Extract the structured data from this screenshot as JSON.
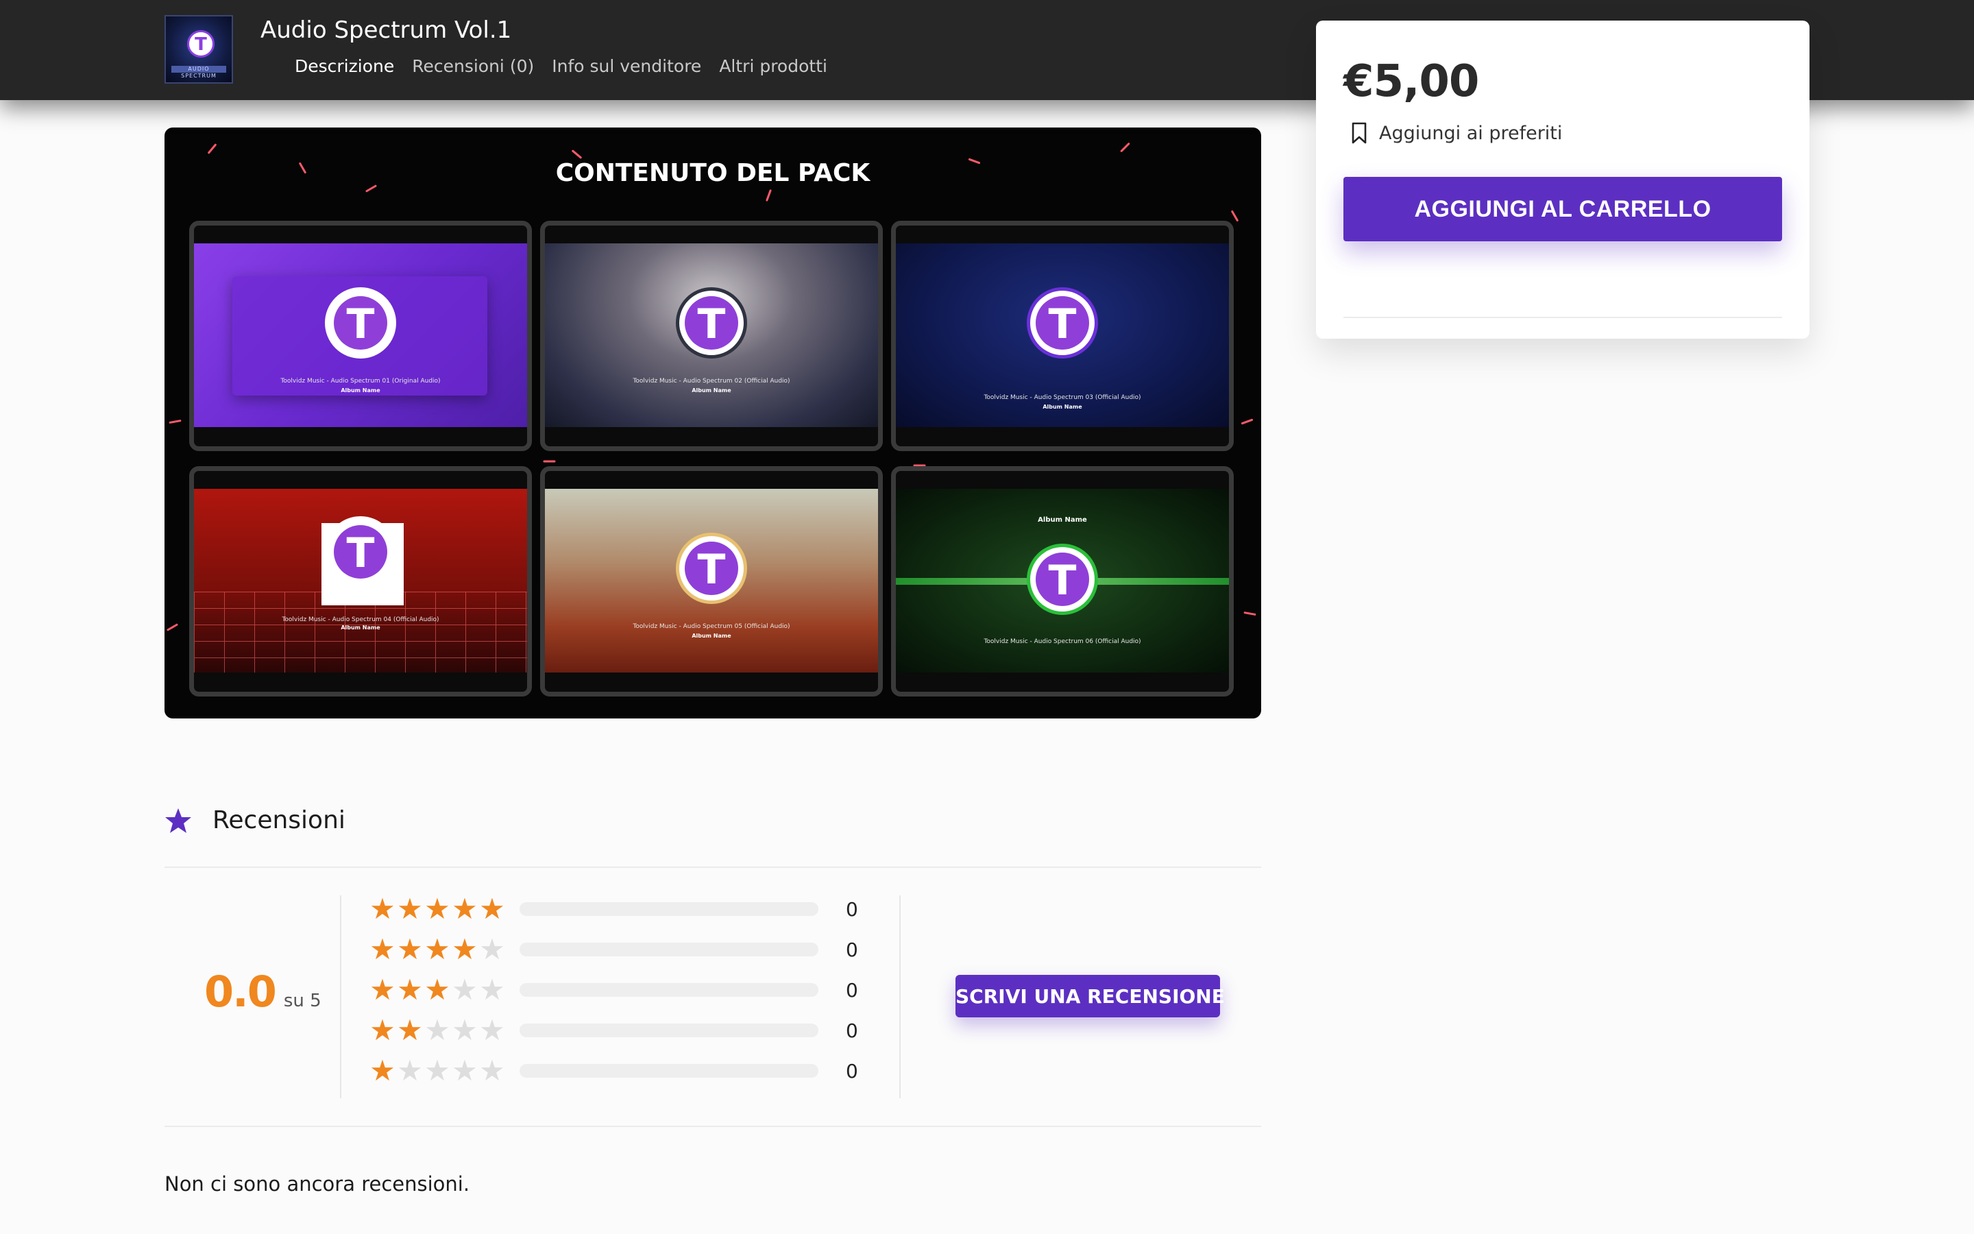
{
  "header": {
    "product_title": "Audio Spectrum Vol.1",
    "thumbnail_caption": "AUDIO SPECTRUM",
    "tabs": [
      {
        "label": "Descrizione",
        "active": true
      },
      {
        "label": "Recensioni (0)",
        "active": false
      },
      {
        "label": "Info sul venditore",
        "active": false
      },
      {
        "label": "Altri prodotti",
        "active": false
      }
    ]
  },
  "purchase": {
    "price": "€5,00",
    "wishlist_label": "Aggiungi ai preferiti",
    "cart_button": "AGGIUNGI AL CARRELLO"
  },
  "pack_preview": {
    "title": "CONTENUTO DEL PACK",
    "logo_letter": "T",
    "tiles": [
      {
        "caption": "Toolvidz Music - Audio Spectrum 01 (Original Audio)",
        "subcaption": "Album Name",
        "toptext": ""
      },
      {
        "caption": "Toolvidz Music - Audio Spectrum 02 (Official Audio)",
        "subcaption": "Album Name",
        "toptext": ""
      },
      {
        "caption": "Toolvidz Music - Audio Spectrum 03 (Official Audio)",
        "subcaption": "Album Name",
        "toptext": ""
      },
      {
        "caption": "Toolvidz Music - Audio Spectrum 04 (Official Audio)",
        "subcaption": "Album Name",
        "toptext": ""
      },
      {
        "caption": "Toolvidz Music - Audio Spectrum 05 (Official Audio)",
        "subcaption": "Album Name",
        "toptext": ""
      },
      {
        "caption": "Toolvidz Music - Audio Spectrum 06 (Official Audio)",
        "subcaption": "",
        "toptext": "Album Name"
      }
    ]
  },
  "reviews": {
    "title": "Recensioni",
    "average": "0.0",
    "average_suffix": "su 5",
    "breakdown": [
      {
        "stars": 5,
        "count": "0",
        "fraction": 0
      },
      {
        "stars": 4,
        "count": "0",
        "fraction": 0
      },
      {
        "stars": 3,
        "count": "0",
        "fraction": 0
      },
      {
        "stars": 2,
        "count": "0",
        "fraction": 0
      },
      {
        "stars": 1,
        "count": "0",
        "fraction": 0
      }
    ],
    "write_button": "SCRIVI UNA RECENSIONE",
    "empty_message": "Non ci sono ancora recensioni."
  },
  "colors": {
    "accent": "#5c2fc2",
    "rating": "#f0871f",
    "header_bg": "#262626"
  },
  "icons": {
    "wishlist": "bookmark-icon",
    "reviews": "star-icon"
  }
}
